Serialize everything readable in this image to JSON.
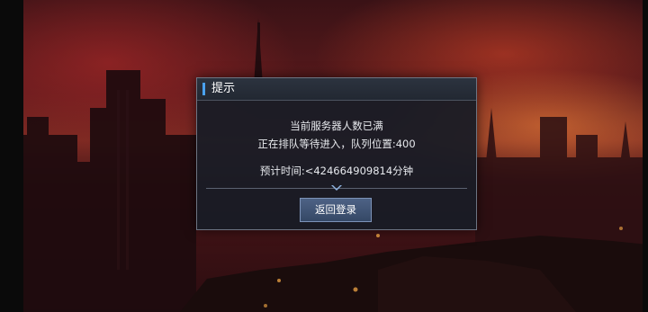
{
  "dialog": {
    "title": "提示",
    "line1": "当前服务器人数已满",
    "line2": "正在排队等待进入，队列位置:400",
    "eta": "预计时间:<424664909814分钟",
    "back_button": "返回登录",
    "divider_icon": "chevron-down-icon"
  },
  "colors": {
    "accent": "#4aa2f0",
    "button": "#3f5478",
    "panel": "#181c26"
  }
}
